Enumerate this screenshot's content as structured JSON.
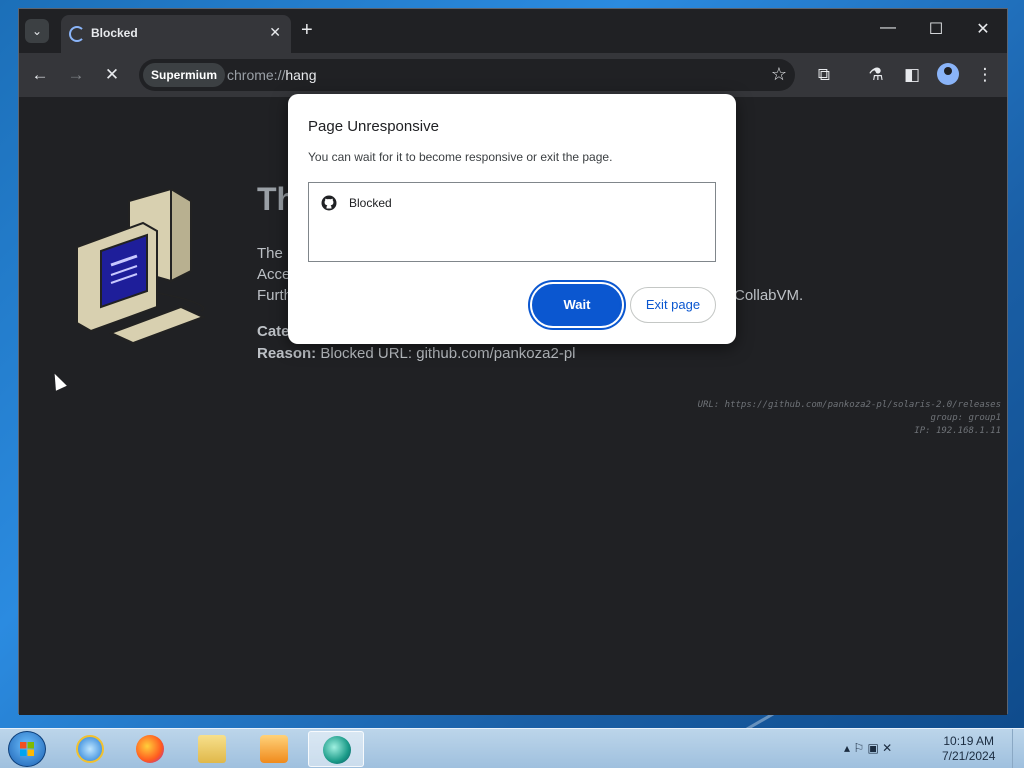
{
  "browser": {
    "tab": {
      "title": "Blocked",
      "close_glyph": "✕"
    },
    "tab_search_glyph": "⌄",
    "new_tab_glyph": "+",
    "window_controls": {
      "minimize": "—",
      "maximize": "☐",
      "close": "✕"
    },
    "toolbar": {
      "back": "←",
      "forward": "→",
      "stop": "✕",
      "chip": "Supermium",
      "url_scheme": "chrome://",
      "url_host": "hang",
      "star": "☆",
      "extensions": "⧉",
      "labs": "⚗",
      "sidepanel": "◧",
      "menu": "⋮"
    }
  },
  "page": {
    "heading": "Th",
    "para_lines": [
      "The",
      "Acce",
      "Furth"
    ],
    "para_right_lines": [
      "VM.",
      "",
      "om CollabVM."
    ],
    "category_label": "Cate",
    "reason_label": "Reason:",
    "reason_value": " Blocked URL: github.com/pankoza2-pl",
    "meta_url": "URL: https://github.com/pankoza2-pl/solaris-2.0/releases",
    "meta_group": "group: group1",
    "meta_ip": "IP: 192.168.1.11"
  },
  "dialog": {
    "title": "Page Unresponsive",
    "subtitle": "You can wait for it to become responsive or exit the page.",
    "item": "Blocked",
    "wait_label": "Wait",
    "exit_label": "Exit page"
  },
  "taskbar": {
    "tray_icons": "▴  ⚐  ▣  ✕",
    "time": "10:19 AM",
    "date": "7/21/2024"
  },
  "colors": {
    "accent": "#0b57d0",
    "page_bg": "#202124",
    "toolbar_bg": "#35363a"
  }
}
